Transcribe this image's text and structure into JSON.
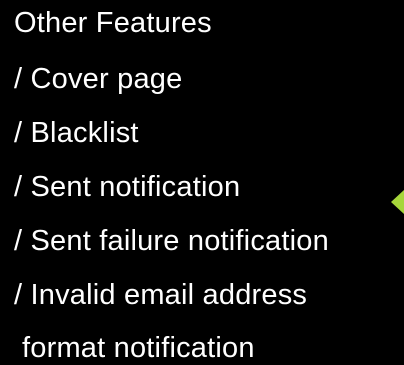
{
  "features_list": {
    "heading": "Other Features",
    "items": [
      "/ Cover page",
      "/ Blacklist",
      "/ Sent notification",
      "/ Sent failure notification",
      "/ Invalid email address",
      "format notification"
    ]
  },
  "pointer": {
    "icon": "left-pointer-arrow-icon",
    "color": "#a6d63a"
  },
  "colors": {
    "background": "#000000",
    "text": "#ffffff"
  }
}
